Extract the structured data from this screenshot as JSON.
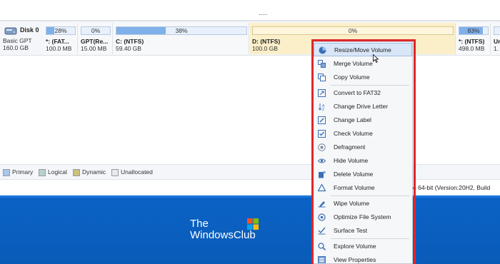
{
  "top": {
    "dots": "....."
  },
  "disk": {
    "name": "Disk 0",
    "type": "Basic GPT",
    "size": "160.0 GB"
  },
  "partitions": [
    {
      "pct": "28%",
      "fill": 0.28,
      "label": "*: (FAT...",
      "size": "100.0 MB"
    },
    {
      "pct": "0%",
      "fill": 0.0,
      "label": "GPT(Re...",
      "size": "15.00 MB"
    },
    {
      "pct": "38%",
      "fill": 0.38,
      "label": "C: (NTFS)",
      "size": "59.40 GB"
    },
    {
      "pct": "0%",
      "fill": 0.0,
      "label": "D: (NTFS)",
      "size": "100.0 GB"
    },
    {
      "pct": "83%",
      "fill": 0.83,
      "label": "*: (NTFS)",
      "size": "498.0 MB"
    },
    {
      "pct": "",
      "fill": 0.0,
      "label": "Ur",
      "size": "1."
    }
  ],
  "legend": [
    {
      "label": "Primary",
      "color": "#a9c7ea"
    },
    {
      "label": "Logical",
      "color": "#b7d3c9"
    },
    {
      "label": "Dynamic",
      "color": "#c9c27a"
    },
    {
      "label": "Unallocated",
      "color": "#e9e9e9"
    }
  ],
  "status": {
    "text": "o 64-bit (Version:20H2, Build"
  },
  "banner": {
    "logo_line1": "The",
    "logo_line2": "WindowsClub"
  },
  "context_menu": {
    "items": [
      {
        "label": "Resize/Move Volume",
        "icon": "resize-icon"
      },
      {
        "label": "Merge Volume",
        "icon": "merge-icon"
      },
      {
        "label": "Copy Volume",
        "icon": "copy-icon"
      },
      {
        "label": "Convert to FAT32",
        "icon": "convert-icon"
      },
      {
        "label": "Change Drive Letter",
        "icon": "drive-letter-icon"
      },
      {
        "label": "Change Label",
        "icon": "label-icon"
      },
      {
        "label": "Check Volume",
        "icon": "check-icon"
      },
      {
        "label": "Defragment",
        "icon": "defragment-icon"
      },
      {
        "label": "Hide Volume",
        "icon": "hide-icon"
      },
      {
        "label": "Delete Volume",
        "icon": "delete-icon"
      },
      {
        "label": "Format Volume",
        "icon": "format-icon"
      },
      {
        "label": "Wipe Volume",
        "icon": "wipe-icon"
      },
      {
        "label": "Optimize File System",
        "icon": "optimize-icon"
      },
      {
        "label": "Surface Test",
        "icon": "surface-test-icon"
      },
      {
        "label": "Explore Volume",
        "icon": "explore-icon"
      },
      {
        "label": "View Properties",
        "icon": "properties-icon"
      }
    ]
  },
  "colors": {
    "accent": "#e0262b",
    "selected_partition": "#fbefc9",
    "banner": "#0b63c6",
    "bar_fill": "#7fb0ea"
  }
}
